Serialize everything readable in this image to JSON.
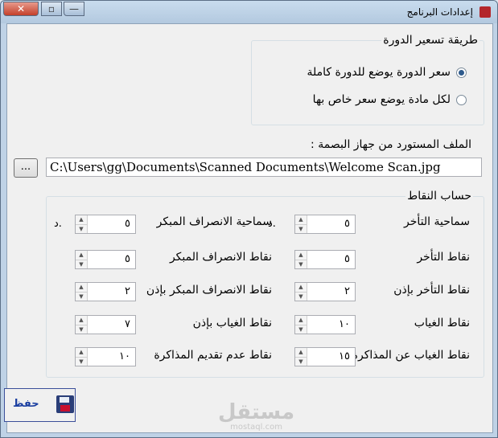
{
  "window": {
    "title": "إعدادات البرنامج",
    "controls": {
      "close": "✕",
      "maximize": "▫",
      "minimize": "—"
    }
  },
  "pricing": {
    "group_label": "طريقة تسعير الدورة",
    "options": [
      {
        "label": "سعر الدورة يوضع للدورة كاملة",
        "checked": true
      },
      {
        "label": "لكل مادة يوضع سعر خاص بها",
        "checked": false
      }
    ]
  },
  "file": {
    "label": "الملف المستورد من جهاز البصمة :",
    "path": "C:\\Users\\gg\\Documents\\Scanned Documents\\Welcome Scan.jpg",
    "browse_label": "..."
  },
  "points": {
    "group_label": "حساب النقاط",
    "unit": "د.",
    "fields": {
      "late_tolerance": {
        "label": "سماحية التأخر",
        "value": "٥"
      },
      "early_leave_tolerance": {
        "label": "سماحية الانصراف المبكر",
        "value": "٥"
      },
      "late_points": {
        "label": "نقاط التأخر",
        "value": "٥"
      },
      "early_leave_points": {
        "label": "نقاط الانصراف المبكر",
        "value": "٥"
      },
      "late_permission_points": {
        "label": "نقاط التأخر بإذن",
        "value": "٢"
      },
      "early_leave_permission_points": {
        "label": "نقاط الانصراف المبكر بإذن",
        "value": "٢"
      },
      "absence_points": {
        "label": "نقاط الغياب",
        "value": "١٠"
      },
      "absence_permission_points": {
        "label": "نقاط الغياب بإذن",
        "value": "٧"
      },
      "study_absence_points": {
        "label": "نقاط الغياب عن المذاكرة",
        "value": "١٥"
      },
      "no_study_submit_points": {
        "label": "نقاط عدم تقديم المذاكرة",
        "value": "١٠"
      }
    }
  },
  "save": {
    "label": "حفظ",
    "icon": "floppy-disk-icon"
  },
  "watermark": {
    "arabic": "مستقل",
    "latin": "mostaql.com"
  }
}
